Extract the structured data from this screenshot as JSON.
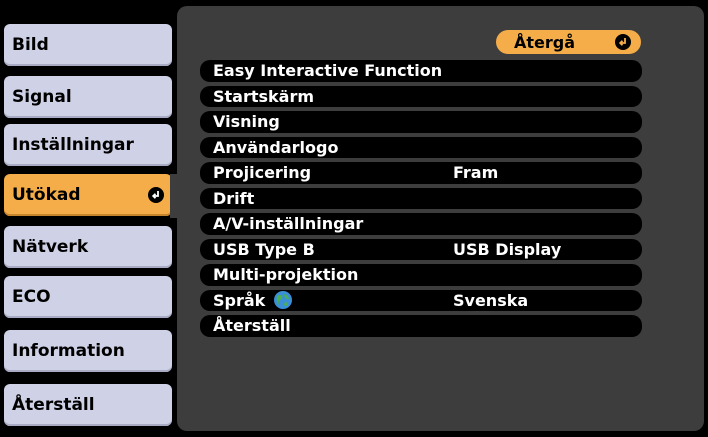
{
  "sidebar": {
    "items": [
      {
        "label": "Bild"
      },
      {
        "label": "Signal"
      },
      {
        "label": "Inställningar"
      },
      {
        "label": "Utökad",
        "active": true
      },
      {
        "label": "Nätverk"
      },
      {
        "label": "ECO"
      },
      {
        "label": "Information"
      },
      {
        "label": "Återställ"
      }
    ]
  },
  "panel": {
    "back_label": "Återgå",
    "items": [
      {
        "label": "Easy Interactive Function",
        "value": ""
      },
      {
        "label": "Startskärm",
        "value": ""
      },
      {
        "label": "Visning",
        "value": ""
      },
      {
        "label": "Användarlogo",
        "value": ""
      },
      {
        "label": "Projicering",
        "value": "Fram"
      },
      {
        "label": "Drift",
        "value": ""
      },
      {
        "label": "A/V-inställningar",
        "value": ""
      },
      {
        "label": "USB Type B",
        "value": "USB Display"
      },
      {
        "label": "Multi-projektion",
        "value": ""
      },
      {
        "label": "Språk",
        "value": "Svenska",
        "icon": "globe-icon"
      },
      {
        "label": "Återställ",
        "value": ""
      }
    ]
  },
  "colors": {
    "accent": "#f4ad48",
    "tab": "#cfd1e6",
    "panel": "#3d3d3d",
    "background": "#000000"
  }
}
